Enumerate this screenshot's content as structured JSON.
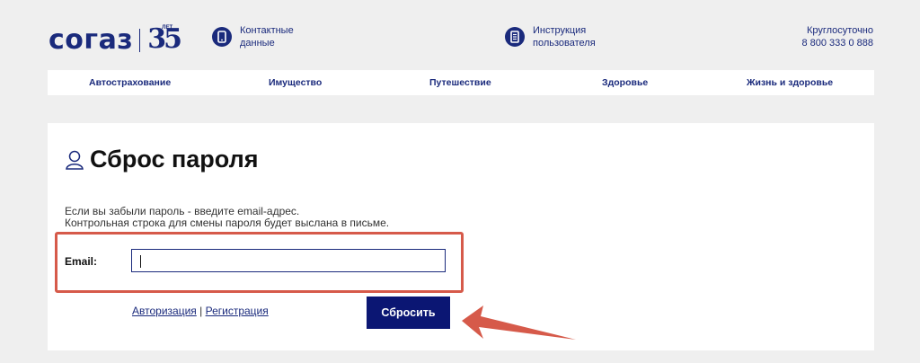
{
  "header": {
    "logo_text": "согаз",
    "logo_number": "35",
    "logo_sup": "ЛЕТ",
    "contacts": {
      "line1": "Контактные",
      "line2": "данные",
      "icon": "phone-icon"
    },
    "manual": {
      "line1": "Инструкция",
      "line2": "пользователя",
      "icon": "document-icon"
    },
    "hotline": {
      "line1": "Круглосуточно",
      "line2": "8 800 333 0 888"
    }
  },
  "nav": {
    "items": [
      {
        "label": "Автострахование"
      },
      {
        "label": "Имущество"
      },
      {
        "label": "Путешествие"
      },
      {
        "label": "Здоровье"
      },
      {
        "label": "Жизнь и здоровье"
      }
    ]
  },
  "form": {
    "title": "Сброс пароля",
    "desc_line1": "Если вы забыли пароль - введите email-адрес.",
    "desc_line2": "Контрольная строка для смены пароля будет выслана в письме.",
    "email_label": "Email:",
    "email_value": "",
    "login_link": "Авторизация",
    "separator": "|",
    "register_link": "Регистрация",
    "submit_label": "Сбросить"
  },
  "colors": {
    "brand": "#1a2a7c",
    "button": "#0b1673",
    "highlight": "#d65a4a",
    "background": "#efefef"
  }
}
